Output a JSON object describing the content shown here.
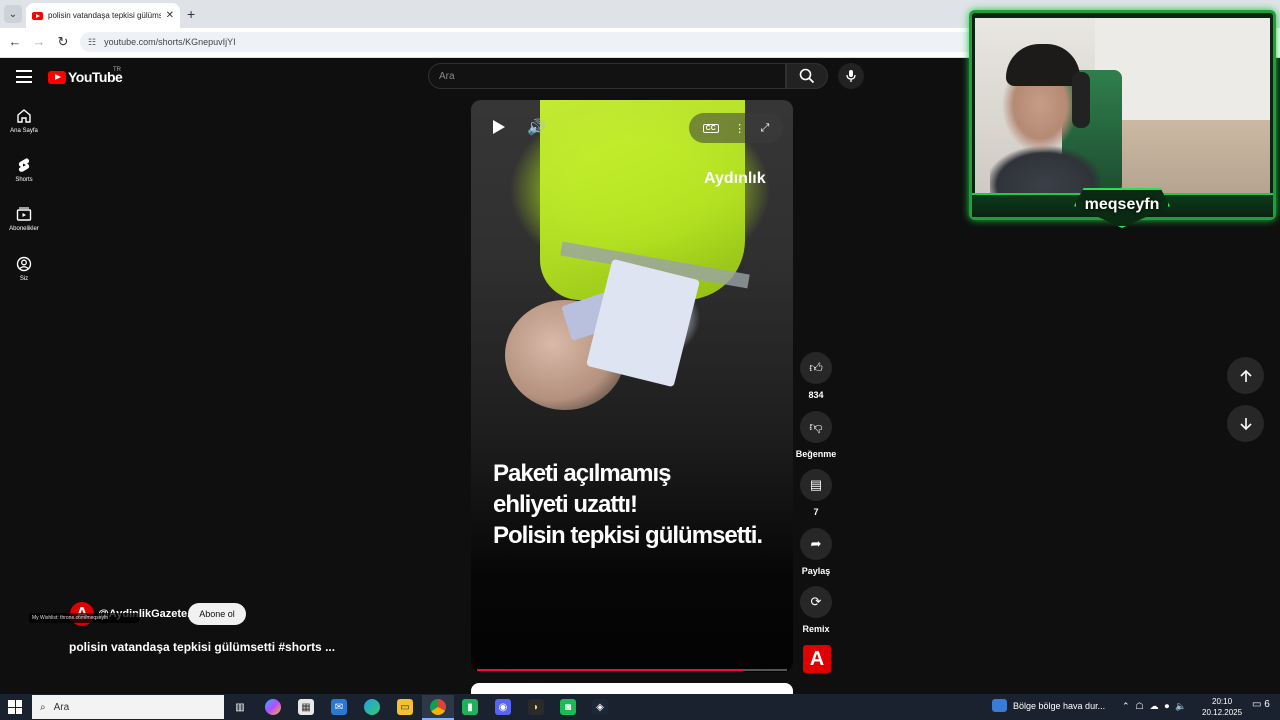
{
  "browser": {
    "tab_title": "polisin vatandaşa tepkisi gülümsetti",
    "url": "youtube.com/shorts/KGnepuvIjYI",
    "new_tab": "+",
    "close": "✕"
  },
  "header": {
    "logo": "YouTube",
    "country": "TR",
    "search_placeholder": "Ara"
  },
  "sidebar": {
    "items": [
      {
        "label": "Ana Sayfa",
        "icon": "home-icon"
      },
      {
        "label": "Shorts",
        "icon": "shorts-icon"
      },
      {
        "label": "Abonelikler",
        "icon": "subscriptions-icon"
      },
      {
        "label": "Siz",
        "icon": "you-icon"
      }
    ]
  },
  "video": {
    "watermark": "Aydınlık",
    "caption": "Paketi açılmamış\nehliyeti uzattı!\nPolisin tepkisi gülümsetti.",
    "progress_fraction": 0.86,
    "title": "polisin vatandaşa tepkisi gülümsetti #shorts ..."
  },
  "channel": {
    "handle": "@AydinlikGazete.",
    "subscribe": "Abone ol",
    "avatar_letter": "A"
  },
  "overlay": {
    "wishlist": "My Wishlist: throne.com/meqseyfn"
  },
  "actions": {
    "like_count": "834",
    "dislike_label": "Beğenme",
    "comment_count": "7",
    "share_label": "Paylaş",
    "remix_label": "Remix"
  },
  "webcam": {
    "name": "meqseyfn"
  },
  "taskbar": {
    "search": "Ara",
    "weather": "Bölge bölge hava dur...",
    "time": "20:10",
    "date": "20.12.2025",
    "notifications": "6"
  },
  "colors": {
    "accent": "#ff0000",
    "progress": "#ff0050",
    "webcam_frame": "#1f9e3a"
  }
}
